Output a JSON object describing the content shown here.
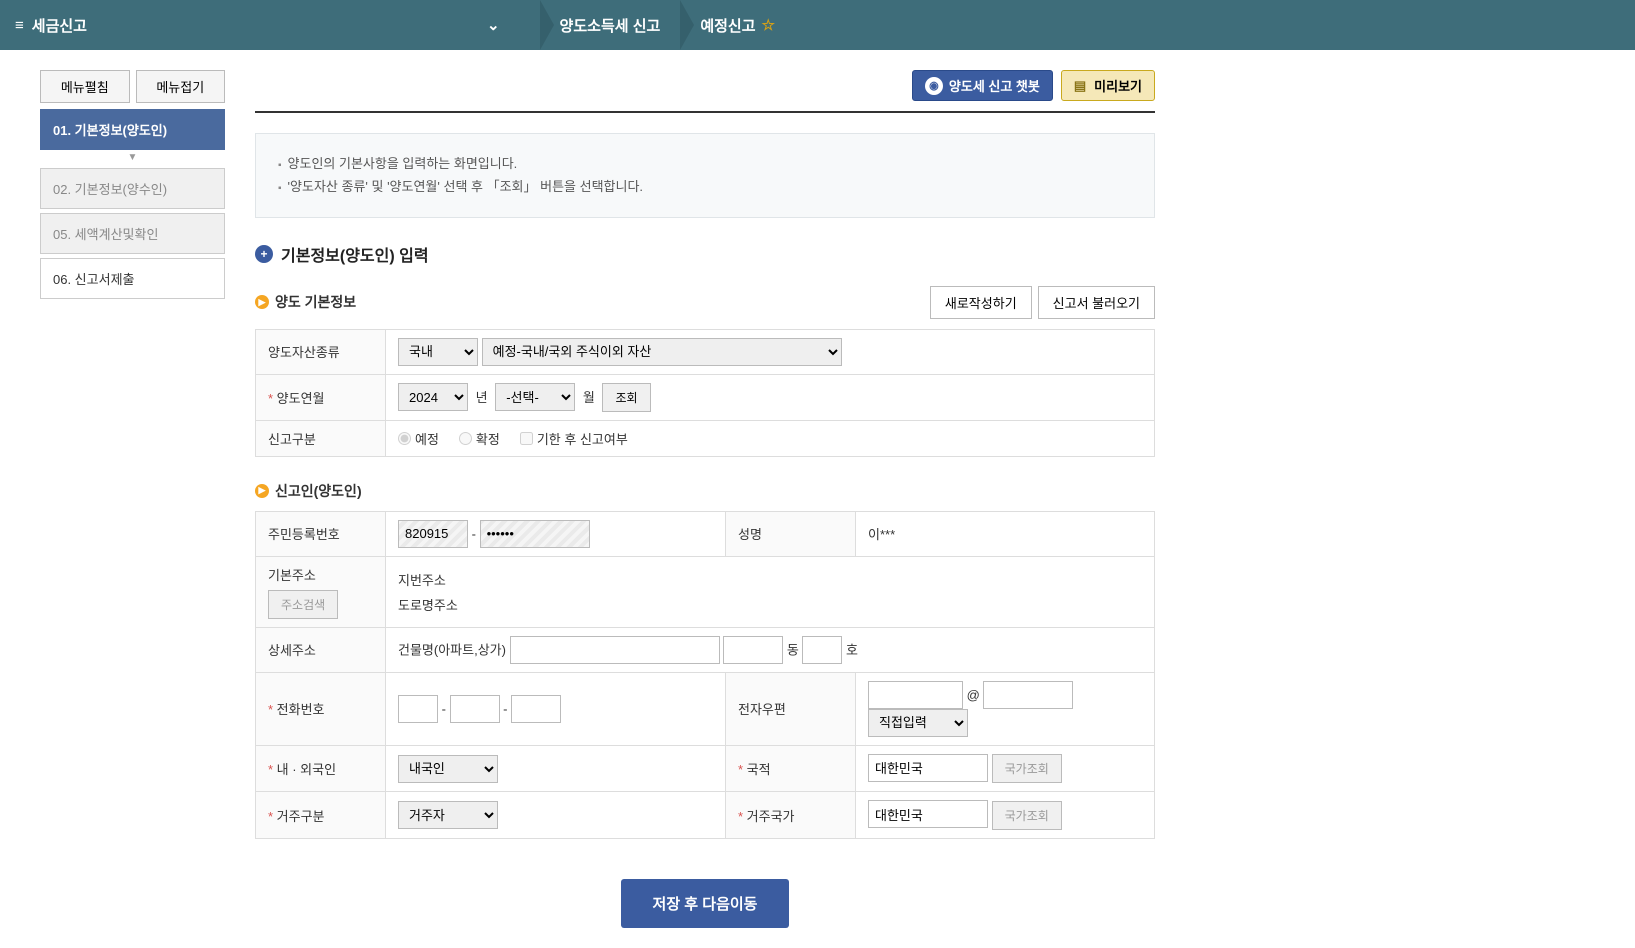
{
  "header": {
    "app_title": "세금신고",
    "breadcrumb": [
      "양도소득세 신고",
      "예정신고"
    ]
  },
  "sidebar": {
    "expand": "메뉴펼침",
    "collapse": "메뉴접기",
    "items": [
      {
        "label": "01. 기본정보(양도인)",
        "active": true
      },
      {
        "label": "02. 기본정보(양수인)"
      },
      {
        "label": "05. 세액계산및확인"
      },
      {
        "label": "06. 신고서제출",
        "white": true
      }
    ]
  },
  "actions": {
    "chatbot": "양도세 신고 챗봇",
    "preview": "미리보기"
  },
  "info": {
    "line1": "양도인의 기본사항을 입력하는 화면입니다.",
    "line2": "'양도자산 종류' 및 '양도연월' 선택 후 「조회」 버튼을 선택합니다."
  },
  "section_title": "기본정보(양도인) 입력",
  "sub1": {
    "title": "양도 기본정보",
    "new": "새로작성하기",
    "load": "신고서 불러오기",
    "asset_type_label": "양도자산종류",
    "asset_loc": "국내",
    "asset_desc": "예정-국내/국외 주식이외 자산",
    "year_label": "양도연월",
    "year_val": "2024",
    "year_suffix": "년",
    "month_val": "-선택-",
    "month_suffix": "월",
    "lookup": "조회",
    "report_type_label": "신고구분",
    "report_opt1": "예정",
    "report_opt2": "확정",
    "report_chk": "기한 후 신고여부"
  },
  "sub2": {
    "title": "신고인(양도인)",
    "rrn_label": "주민등록번호",
    "rrn1": "820915",
    "rrn2": "••••••",
    "name_label": "성명",
    "name_val": "이***",
    "addr_label": "기본주소",
    "addr_btn": "주소검색",
    "addr_jibun": "지번주소",
    "addr_road": "도로명주소",
    "detail_label": "상세주소",
    "building": "건물명(아파트,상가)",
    "dong": "동",
    "ho": "호",
    "phone_label": "전화번호",
    "email_label": "전자우편",
    "email_at": "@",
    "email_domain": "직접입력",
    "foreigner_label": "내 · 외국인",
    "foreigner_val": "내국인",
    "nationality_label": "국적",
    "nationality_val": "대한민국",
    "country_btn": "국가조회",
    "residence_label": "거주구분",
    "residence_val": "거주자",
    "residence_country_label": "거주국가",
    "residence_country_val": "대한민국"
  },
  "footer": {
    "save_next": "저장 후 다음이동"
  }
}
